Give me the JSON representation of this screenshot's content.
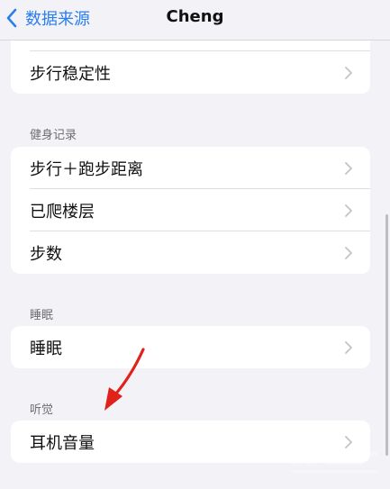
{
  "nav": {
    "back_label": "数据来源",
    "title": "Cheng"
  },
  "groups": [
    {
      "section": "",
      "rows": [
        "步行稳定性"
      ]
    },
    {
      "section": "健身记录",
      "rows": [
        "步行＋跑步距离",
        "已爬楼层",
        "步数"
      ]
    },
    {
      "section": "睡眠",
      "rows": [
        "睡眠"
      ]
    },
    {
      "section": "听觉",
      "rows": [
        "耳机音量"
      ]
    }
  ],
  "colors": {
    "accent": "#2a7ef0",
    "annotation_arrow": "#e0221a",
    "background": "#f2f2f7"
  },
  "icons": [
    "chevron-left-icon",
    "chevron-right-icon",
    "annotation-arrow-icon"
  ]
}
